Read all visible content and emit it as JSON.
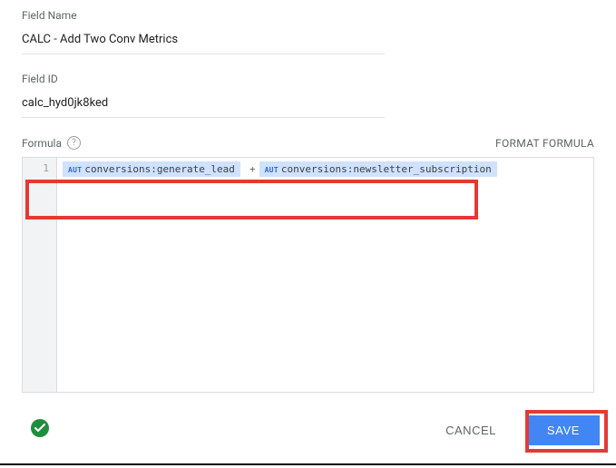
{
  "fields": {
    "name_label": "Field Name",
    "name_value": "CALC - Add Two Conv Metrics",
    "id_label": "Field ID",
    "id_value": "calc_hyd0jk8ked"
  },
  "formula": {
    "label": "Formula",
    "format_label": "FORMAT FORMULA",
    "line_number": "1",
    "token1_tag": "AUT",
    "token1_text": "conversions:generate_lead",
    "operator": "+",
    "token2_tag": "AUT",
    "token2_text": "conversions:newsletter_subscription"
  },
  "actions": {
    "cancel": "CANCEL",
    "save": "SAVE"
  }
}
